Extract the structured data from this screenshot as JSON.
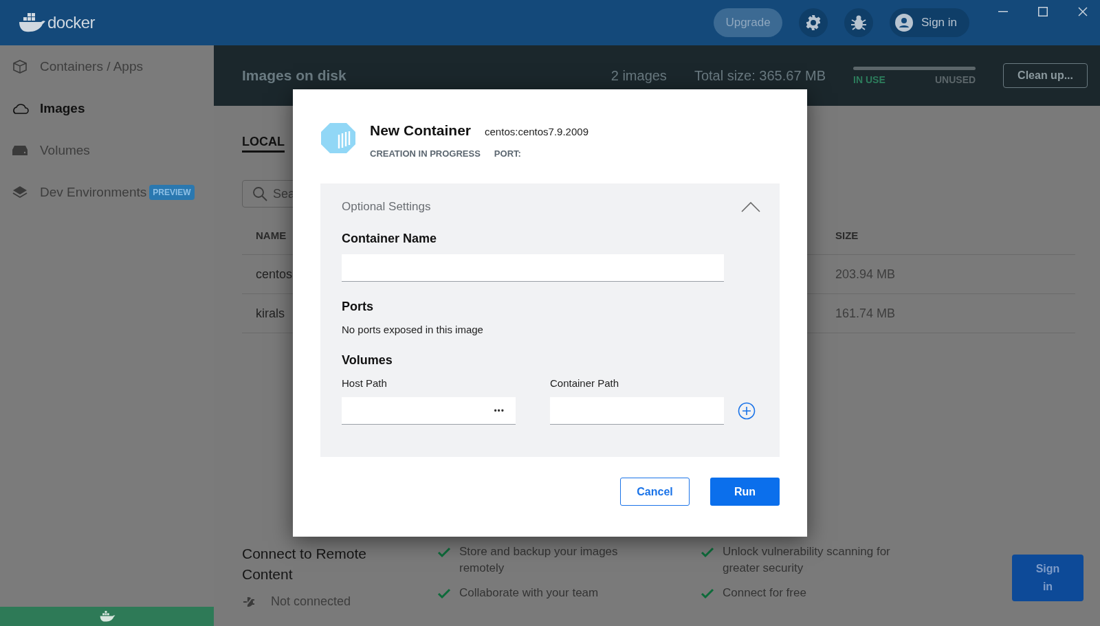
{
  "app": {
    "logo": "docker",
    "upgrade": "Upgrade",
    "sign_in": "Sign in"
  },
  "sidebar": {
    "items": [
      {
        "kind": "containers",
        "label": "Containers / Apps",
        "selected": false
      },
      {
        "kind": "images",
        "label": "Images",
        "selected": true
      },
      {
        "kind": "volumes",
        "label": "Volumes",
        "selected": false
      },
      {
        "kind": "devenv",
        "label": "Dev Environments",
        "badge": "PREVIEW",
        "selected": false
      }
    ]
  },
  "header": {
    "title": "Images on disk",
    "count": "2 images",
    "total": "Total size: 365.67 MB",
    "in_use": "IN USE",
    "unused": "UNUSED",
    "cleanup": "Clean up..."
  },
  "tabs": [
    {
      "label": "LOCAL",
      "selected": true
    }
  ],
  "search": {
    "placeholder": "Sea"
  },
  "table": {
    "columns": [
      "NAME",
      "SIZE"
    ],
    "rows": [
      {
        "name": "centos",
        "size": "203.94 MB"
      },
      {
        "name": "kirals",
        "size": "161.74 MB"
      }
    ]
  },
  "modal": {
    "title": "New Container",
    "image": "centos:centos7.9.2009",
    "status": "CREATION IN PROGRESS",
    "port": "PORT:",
    "optional": {
      "title": "Optional Settings",
      "expanded": true
    },
    "container_name": {
      "label": "Container Name"
    },
    "ports": {
      "label": "Ports",
      "text": "No ports exposed in this image"
    },
    "volumes": {
      "label": "Volumes",
      "host_path": "Host Path",
      "container_path": "Container Path",
      "browse": "•••"
    },
    "buttons": {
      "cancel": "Cancel",
      "run": "Run"
    }
  },
  "remote": {
    "title": "Connect to Remote Content",
    "status": "Not connected",
    "features": [
      "Store and backup your images remotely",
      "Unlock vulnerability scanning for greater security",
      "Collaborate with your team",
      "Connect for free"
    ],
    "button": "Sign in"
  }
}
